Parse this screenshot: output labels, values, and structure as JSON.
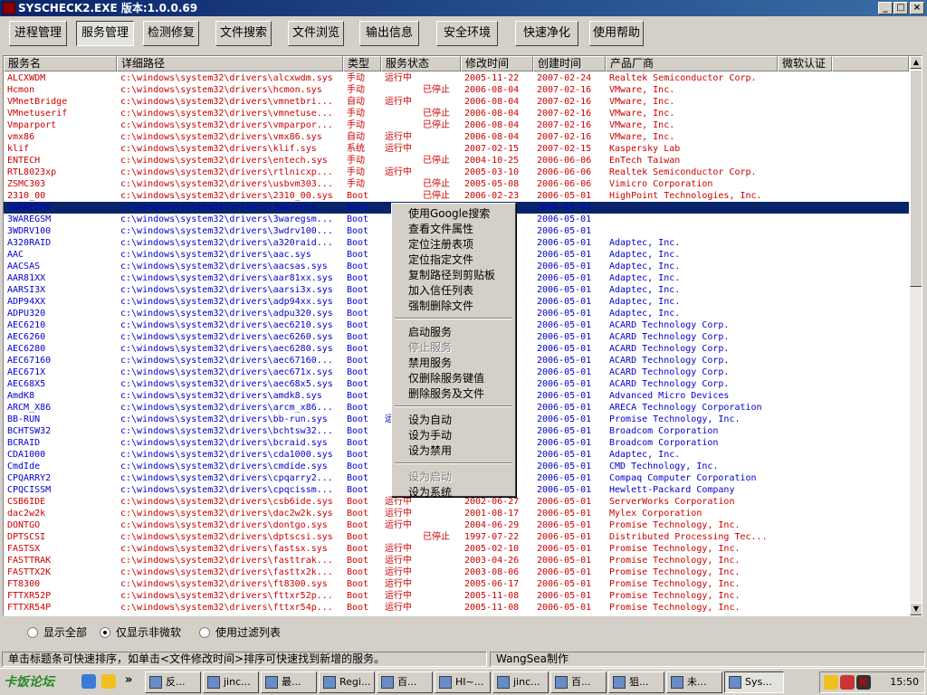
{
  "window": {
    "title": "SYSCHECK2.EXE 版本:1.0.0.69",
    "min": "_",
    "max": "□",
    "close": "×"
  },
  "toolbar": [
    "进程管理",
    "服务管理",
    "检测修复",
    "文件搜索",
    "文件浏览",
    "输出信息",
    "安全环境",
    "快速净化",
    "使用帮助"
  ],
  "columns": [
    "服务名",
    "详细路径",
    "类型",
    "服务状态",
    "修改时间",
    "创建时间",
    "产品厂商",
    "微软认证"
  ],
  "colors": {
    "red": "#cc0000",
    "blue": "#0000cc",
    "selected_bg": "#0a246a"
  },
  "rows": [
    {
      "name": "ALCXWDM",
      "path": "c:\\windows\\system32\\drivers\\alcxwdm.sys",
      "type": "手动",
      "status": "运行中",
      "mod": "2005-11-22",
      "created": "2007-02-24",
      "vendor": "Realtek Semiconductor Corp.",
      "color": "red"
    },
    {
      "name": "Hcmon",
      "path": "c:\\windows\\system32\\drivers\\hcmon.sys",
      "type": "手动",
      "status": "已停止",
      "mod": "2006-08-04",
      "created": "2007-02-16",
      "vendor": "VMware, Inc.",
      "color": "red"
    },
    {
      "name": "VMnetBridge",
      "path": "c:\\windows\\system32\\drivers\\vmnetbri...",
      "type": "自动",
      "status": "运行中",
      "mod": "2006-08-04",
      "created": "2007-02-16",
      "vendor": "VMware, Inc.",
      "color": "red"
    },
    {
      "name": "VMnetuserif",
      "path": "c:\\windows\\system32\\drivers\\vmnetuse...",
      "type": "手动",
      "status": "已停止",
      "mod": "2006-08-04",
      "created": "2007-02-16",
      "vendor": "VMware, Inc.",
      "color": "red"
    },
    {
      "name": "Vmparport",
      "path": "c:\\windows\\system32\\drivers\\vmparpor...",
      "type": "手动",
      "status": "已停止",
      "mod": "2006-08-04",
      "created": "2007-02-16",
      "vendor": "VMware, Inc.",
      "color": "red"
    },
    {
      "name": "vmx86",
      "path": "c:\\windows\\system32\\drivers\\vmx86.sys",
      "type": "自动",
      "status": "运行中",
      "mod": "2006-08-04",
      "created": "2007-02-16",
      "vendor": "VMware, Inc.",
      "color": "red"
    },
    {
      "name": "klif",
      "path": "c:\\windows\\system32\\drivers\\klif.sys",
      "type": "系统",
      "status": "运行中",
      "mod": "2007-02-15",
      "created": "2007-02-15",
      "vendor": "Kaspersky Lab",
      "color": "red"
    },
    {
      "name": "ENTECH",
      "path": "c:\\windows\\system32\\drivers\\entech.sys",
      "type": "手动",
      "status": "已停止",
      "mod": "2004-10-25",
      "created": "2006-06-06",
      "vendor": "EnTech Taiwan",
      "color": "red"
    },
    {
      "name": "RTL8023xp",
      "path": "c:\\windows\\system32\\drivers\\rtlnicxp...",
      "type": "手动",
      "status": "运行中",
      "mod": "2005-03-10",
      "created": "2006-06-06",
      "vendor": "Realtek Semiconductor Corp.",
      "color": "red"
    },
    {
      "name": "ZSMC303",
      "path": "c:\\windows\\system32\\drivers\\usbvm303...",
      "type": "手动",
      "status": "已停止",
      "mod": "2005-05-08",
      "created": "2006-06-06",
      "vendor": "Vimicro Corporation",
      "color": "red"
    },
    {
      "name": "2310_00",
      "path": "c:\\windows\\system32\\drivers\\2310_00.sys",
      "type": "Boot",
      "status": "已停止",
      "mod": "2006-02-23",
      "created": "2006-05-01",
      "vendor": "HighPoint Technologies, Inc.",
      "color": "red"
    },
    {
      "name": "3WAREDRV",
      "path": "c:\\windows\\system32\\drivers\\3waredrv...",
      "type": "Boot",
      "status": "",
      "mod": "",
      "created": "2006-05-01",
      "vendor": "",
      "color": "blue",
      "selected": true
    },
    {
      "name": "3WAREGSM",
      "path": "c:\\windows\\system32\\drivers\\3waregsm...",
      "type": "Boot",
      "status": "",
      "mod": "",
      "created": "2006-05-01",
      "vendor": "",
      "color": "blue"
    },
    {
      "name": "3WDRV100",
      "path": "c:\\windows\\system32\\drivers\\3wdrv100...",
      "type": "Boot",
      "status": "",
      "mod": "",
      "created": "2006-05-01",
      "vendor": "",
      "color": "blue"
    },
    {
      "name": "A320RAID",
      "path": "c:\\windows\\system32\\drivers\\a320raid...",
      "type": "Boot",
      "status": "",
      "mod": "",
      "created": "2006-05-01",
      "vendor": "Adaptec, Inc.",
      "color": "blue"
    },
    {
      "name": "AAC",
      "path": "c:\\windows\\system32\\drivers\\aac.sys",
      "type": "Boot",
      "status": "",
      "mod": "",
      "created": "2006-05-01",
      "vendor": "Adaptec, Inc.",
      "color": "blue"
    },
    {
      "name": "AACSAS",
      "path": "c:\\windows\\system32\\drivers\\aacsas.sys",
      "type": "Boot",
      "status": "",
      "mod": "",
      "created": "2006-05-01",
      "vendor": "Adaptec, Inc.",
      "color": "blue"
    },
    {
      "name": "AAR81XX",
      "path": "c:\\windows\\system32\\drivers\\aar81xx.sys",
      "type": "Boot",
      "status": "",
      "mod": "",
      "created": "2006-05-01",
      "vendor": "Adaptec, Inc.",
      "color": "blue"
    },
    {
      "name": "AARSI3X",
      "path": "c:\\windows\\system32\\drivers\\aarsi3x.sys",
      "type": "Boot",
      "status": "",
      "mod": "",
      "created": "2006-05-01",
      "vendor": "Adaptec, Inc.",
      "color": "blue"
    },
    {
      "name": "ADP94XX",
      "path": "c:\\windows\\system32\\drivers\\adp94xx.sys",
      "type": "Boot",
      "status": "",
      "mod": "",
      "created": "2006-05-01",
      "vendor": "Adaptec, Inc.",
      "color": "blue"
    },
    {
      "name": "ADPU320",
      "path": "c:\\windows\\system32\\drivers\\adpu320.sys",
      "type": "Boot",
      "status": "",
      "mod": "",
      "created": "2006-05-01",
      "vendor": "Adaptec, Inc.",
      "color": "blue"
    },
    {
      "name": "AEC6210",
      "path": "c:\\windows\\system32\\drivers\\aec6210.sys",
      "type": "Boot",
      "status": "",
      "mod": "",
      "created": "2006-05-01",
      "vendor": "ACARD Technology Corp.",
      "color": "blue"
    },
    {
      "name": "AEC6260",
      "path": "c:\\windows\\system32\\drivers\\aec6260.sys",
      "type": "Boot",
      "status": "",
      "mod": "",
      "created": "2006-05-01",
      "vendor": "ACARD Technology Corp.",
      "color": "blue"
    },
    {
      "name": "AEC6280",
      "path": "c:\\windows\\system32\\drivers\\aec6280.sys",
      "type": "Boot",
      "status": "",
      "mod": "",
      "created": "2006-05-01",
      "vendor": "ACARD Technology Corp.",
      "color": "blue"
    },
    {
      "name": "AEC67160",
      "path": "c:\\windows\\system32\\drivers\\aec67160...",
      "type": "Boot",
      "status": "",
      "mod": "",
      "created": "2006-05-01",
      "vendor": "ACARD Technology Corp.",
      "color": "blue"
    },
    {
      "name": "AEC671X",
      "path": "c:\\windows\\system32\\drivers\\aec671x.sys",
      "type": "Boot",
      "status": "",
      "mod": "",
      "created": "2006-05-01",
      "vendor": "ACARD Technology Corp.",
      "color": "blue"
    },
    {
      "name": "AEC68X5",
      "path": "c:\\windows\\system32\\drivers\\aec68x5.sys",
      "type": "Boot",
      "status": "",
      "mod": "",
      "created": "2006-05-01",
      "vendor": "ACARD Technology Corp.",
      "color": "blue"
    },
    {
      "name": "AmdK8",
      "path": "c:\\windows\\system32\\drivers\\amdk8.sys",
      "type": "Boot",
      "status": "",
      "mod": "",
      "created": "2006-05-01",
      "vendor": "Advanced Micro Devices",
      "color": "blue"
    },
    {
      "name": "ARCM_X86",
      "path": "c:\\windows\\system32\\drivers\\arcm_x86...",
      "type": "Boot",
      "status": "",
      "mod": "",
      "created": "2006-05-01",
      "vendor": "ARECA  Technology Corporation",
      "color": "blue"
    },
    {
      "name": "BB-RUN",
      "path": "c:\\windows\\system32\\drivers\\bb-run.sys",
      "type": "Boot",
      "status": "运",
      "mod": "",
      "created": "2006-05-01",
      "vendor": "Promise Technology, Inc.",
      "color": "blue"
    },
    {
      "name": "BCHTSW32",
      "path": "c:\\windows\\system32\\drivers\\bchtsw32...",
      "type": "Boot",
      "status": "",
      "mod": "",
      "created": "2006-05-01",
      "vendor": "Broadcom Corporation",
      "color": "blue"
    },
    {
      "name": "BCRAID",
      "path": "c:\\windows\\system32\\drivers\\bcraid.sys",
      "type": "Boot",
      "status": "",
      "mod": "",
      "created": "2006-05-01",
      "vendor": "Broadcom Corporation",
      "color": "blue"
    },
    {
      "name": "CDA1000",
      "path": "c:\\windows\\system32\\drivers\\cda1000.sys",
      "type": "Boot",
      "status": "",
      "mod": "",
      "created": "2006-05-01",
      "vendor": "Adaptec, Inc.",
      "color": "blue"
    },
    {
      "name": "CmdIde",
      "path": "c:\\windows\\system32\\drivers\\cmdide.sys",
      "type": "Boot",
      "status": "",
      "mod": "",
      "created": "2006-05-01",
      "vendor": "CMD Technology, Inc.",
      "color": "blue"
    },
    {
      "name": "CPQARRY2",
      "path": "c:\\windows\\system32\\drivers\\cpqarry2...",
      "type": "Boot",
      "status": "",
      "mod": "",
      "created": "2006-05-01",
      "vendor": "Compaq Computer Corporation",
      "color": "blue"
    },
    {
      "name": "CPQCISSM",
      "path": "c:\\windows\\system32\\drivers\\cpqcissm...",
      "type": "Boot",
      "status": "",
      "mod": "",
      "created": "2006-05-01",
      "vendor": "Hewlett-Packard Company",
      "color": "blue"
    },
    {
      "name": "CSB6IDE",
      "path": "c:\\windows\\system32\\drivers\\csb6ide.sys",
      "type": "Boot",
      "status": "运行中",
      "mod": "2002-06-27",
      "created": "2006-05-01",
      "vendor": "ServerWorks Corporation",
      "color": "red"
    },
    {
      "name": "dac2w2k",
      "path": "c:\\windows\\system32\\drivers\\dac2w2k.sys",
      "type": "Boot",
      "status": "运行中",
      "mod": "2001-08-17",
      "created": "2006-05-01",
      "vendor": "Mylex Corporation",
      "color": "red"
    },
    {
      "name": "DONTGO",
      "path": "c:\\windows\\system32\\drivers\\dontgo.sys",
      "type": "Boot",
      "status": "运行中",
      "mod": "2004-06-29",
      "created": "2006-05-01",
      "vendor": "Promise Technology, Inc.",
      "color": "red"
    },
    {
      "name": "DPTSCSI",
      "path": "c:\\windows\\system32\\drivers\\dptscsi.sys",
      "type": "Boot",
      "status": "已停止",
      "mod": "1997-07-22",
      "created": "2006-05-01",
      "vendor": "Distributed Processing Tec...",
      "color": "red"
    },
    {
      "name": "FASTSX",
      "path": "c:\\windows\\system32\\drivers\\fastsx.sys",
      "type": "Boot",
      "status": "运行中",
      "mod": "2005-02-10",
      "created": "2006-05-01",
      "vendor": "Promise Technology, Inc.",
      "color": "red"
    },
    {
      "name": "FASTTRAK",
      "path": "c:\\windows\\system32\\drivers\\fasttrak...",
      "type": "Boot",
      "status": "运行中",
      "mod": "2003-04-26",
      "created": "2006-05-01",
      "vendor": "Promise Technology, Inc.",
      "color": "red"
    },
    {
      "name": "FASTTX2K",
      "path": "c:\\windows\\system32\\drivers\\fasttx2k...",
      "type": "Boot",
      "status": "运行中",
      "mod": "2003-08-06",
      "created": "2006-05-01",
      "vendor": "Promise Technology, Inc.",
      "color": "red"
    },
    {
      "name": "FT8300",
      "path": "c:\\windows\\system32\\drivers\\ft8300.sys",
      "type": "Boot",
      "status": "运行中",
      "mod": "2005-06-17",
      "created": "2006-05-01",
      "vendor": "Promise Technology, Inc.",
      "color": "red"
    },
    {
      "name": "FTTXR52P",
      "path": "c:\\windows\\system32\\drivers\\fttxr52p...",
      "type": "Boot",
      "status": "运行中",
      "mod": "2005-11-08",
      "created": "2006-05-01",
      "vendor": "Promise Technology, Inc.",
      "color": "red"
    },
    {
      "name": "FTTXR54P",
      "path": "c:\\windows\\system32\\drivers\\fttxr54p...",
      "type": "Boot",
      "status": "运行中",
      "mod": "2005-11-08",
      "created": "2006-05-01",
      "vendor": "Promise Technology, Inc.",
      "color": "red"
    }
  ],
  "context_menu": [
    {
      "label": "使用Google搜索"
    },
    {
      "label": "查看文件属性"
    },
    {
      "label": "定位注册表项"
    },
    {
      "label": "定位指定文件"
    },
    {
      "label": "复制路径到剪贴板"
    },
    {
      "label": "加入信任列表"
    },
    {
      "label": "强制删除文件"
    },
    {
      "sep": true
    },
    {
      "label": "启动服务"
    },
    {
      "label": "停止服务",
      "disabled": true
    },
    {
      "label": "禁用服务"
    },
    {
      "label": "仅删除服务键值"
    },
    {
      "label": "删除服务及文件"
    },
    {
      "sep": true
    },
    {
      "label": "设为自动"
    },
    {
      "label": "设为手动"
    },
    {
      "label": "设为禁用"
    },
    {
      "sep": true
    },
    {
      "label": "设为启动",
      "disabled": true
    },
    {
      "label": "设为系统"
    }
  ],
  "filters": {
    "all": "显示全部",
    "non_ms": "仅显示非微软",
    "filter_list": "使用过滤列表",
    "selected": "non_ms"
  },
  "status": {
    "hint": "单击标题条可快速排序，如单击<文件修改时间>排序可快速找到新增的服务。",
    "author": "WangSea制作"
  },
  "taskbar": {
    "logo": "卡饭论坛",
    "more": "»",
    "items": [
      "反...",
      "jinc...",
      "最...",
      "Regi...",
      "百...",
      "HI~...",
      "jinc...",
      "百...",
      "狙...",
      "未...",
      "Sys..."
    ],
    "active": "Sys...",
    "clock": "15:50"
  }
}
